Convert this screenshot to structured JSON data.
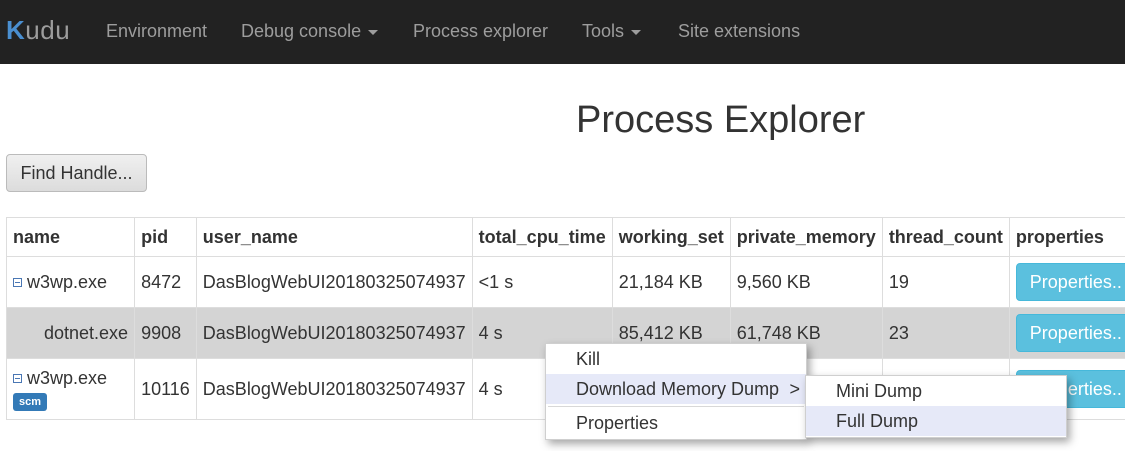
{
  "navbar": {
    "brand_first": "K",
    "brand_rest": "udu",
    "items": [
      {
        "label": "Environment"
      },
      {
        "label": "Debug console",
        "dropdown": true
      },
      {
        "label": "Process explorer"
      },
      {
        "label": "Tools",
        "dropdown": true
      },
      {
        "label": "Site extensions"
      }
    ]
  },
  "page": {
    "title": "Process Explorer",
    "find_handle_label": "Find Handle..."
  },
  "table": {
    "columns": [
      "name",
      "pid",
      "user_name",
      "total_cpu_time",
      "working_set",
      "private_memory",
      "thread_count",
      "properties"
    ],
    "rows": [
      {
        "name": "w3wp.exe",
        "pid": "8472",
        "user_name": "DasBlogWebUI20180325074937",
        "total_cpu_time": "<1 s",
        "working_set": "21,184 KB",
        "private_memory": "9,560 KB",
        "thread_count": "19",
        "properties_label": "Properties.."
      },
      {
        "name": "dotnet.exe",
        "pid": "9908",
        "user_name": "DasBlogWebUI20180325074937",
        "total_cpu_time": "4 s",
        "working_set": "85,412 KB",
        "private_memory": "61,748 KB",
        "thread_count": "23",
        "properties_label": "Properties.."
      },
      {
        "name": "w3wp.exe",
        "badge": "scm",
        "pid": "10116",
        "user_name": "DasBlogWebUI20180325074937",
        "total_cpu_time": "4 s",
        "working_set": "",
        "private_memory": "",
        "thread_count": "",
        "properties_label": "Properties.."
      }
    ]
  },
  "context_menu": {
    "kill": "Kill",
    "download_dump": "Download Memory Dump",
    "submenu_arrow": ">",
    "properties": "Properties"
  },
  "submenu": {
    "mini_dump": "Mini Dump",
    "full_dump": "Full Dump"
  },
  "colors": {
    "navbar_bg": "#222222",
    "properties_button": "#5bc0de",
    "badge": "#337ab7",
    "selected_row": "#d4d4d4"
  }
}
